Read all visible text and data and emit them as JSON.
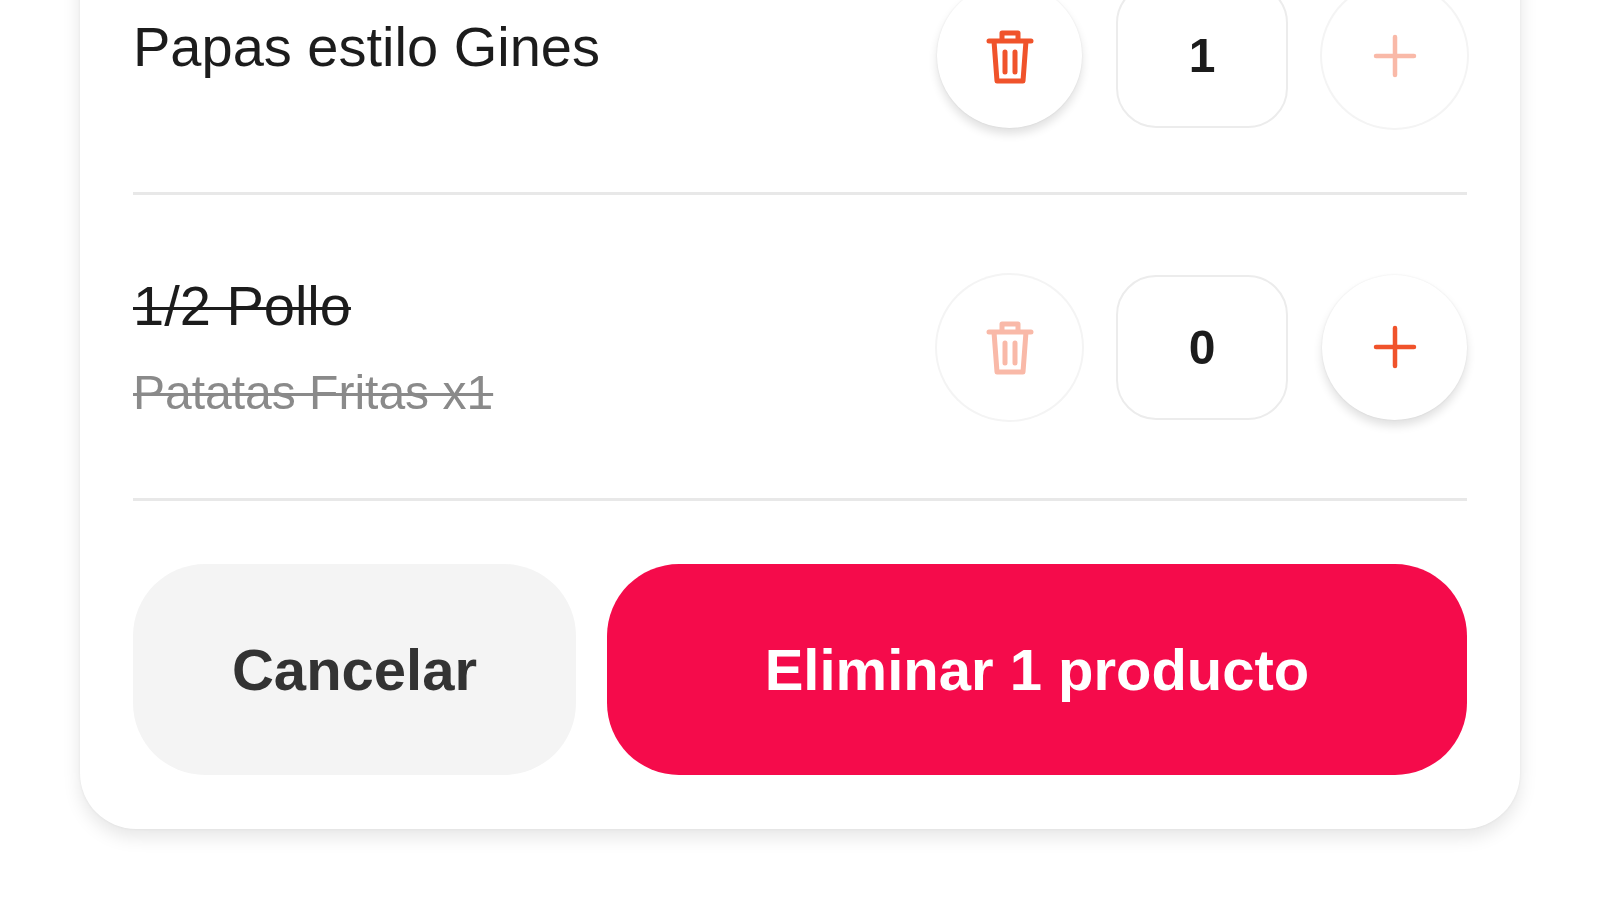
{
  "items": [
    {
      "name": "Papas estilo Gines",
      "removed": false,
      "quantity": "1",
      "trash": {
        "disabled": false
      },
      "plus": {
        "disabled": true
      }
    },
    {
      "name": "1/2 Pollo",
      "subtitle": "Patatas Fritas x1",
      "removed": true,
      "quantity": "0",
      "trash": {
        "disabled": true
      },
      "plus": {
        "disabled": false
      }
    }
  ],
  "buttons": {
    "cancel": "Cancelar",
    "confirm": "Eliminar 1 producto"
  }
}
